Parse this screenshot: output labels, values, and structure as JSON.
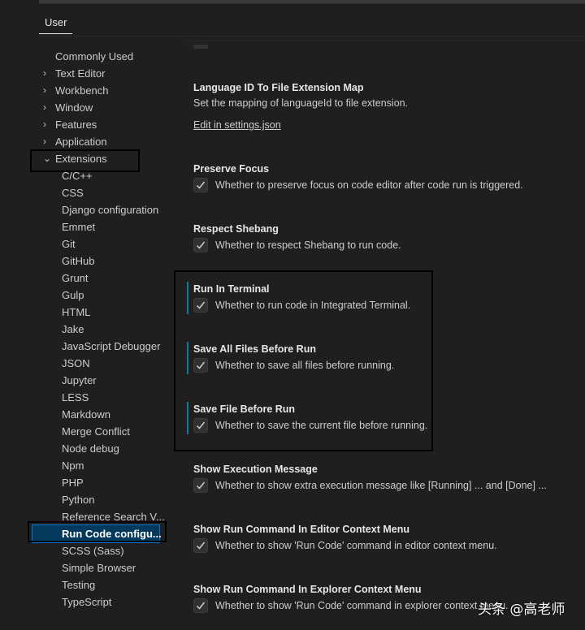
{
  "tabs": [
    {
      "label": "User",
      "active": true
    }
  ],
  "sidebar": {
    "items": [
      {
        "label": "Commonly Used",
        "chevron": ""
      },
      {
        "label": "Text Editor",
        "chevron": "›"
      },
      {
        "label": "Workbench",
        "chevron": "›"
      },
      {
        "label": "Window",
        "chevron": "›"
      },
      {
        "label": "Features",
        "chevron": "›"
      },
      {
        "label": "Application",
        "chevron": "›"
      },
      {
        "label": "Extensions",
        "chevron": "⌄"
      }
    ],
    "extensions": [
      "C/C++",
      "CSS",
      "Django configuration",
      "Emmet",
      "Git",
      "GitHub",
      "Grunt",
      "Gulp",
      "HTML",
      "Jake",
      "JavaScript Debugger",
      "JSON",
      "Jupyter",
      "LESS",
      "Markdown",
      "Merge Conflict",
      "Node debug",
      "Npm",
      "PHP",
      "Python",
      "Reference Search V...",
      "Run Code configu...",
      "SCSS (Sass)",
      "Simple Browser",
      "Testing",
      "TypeScript"
    ],
    "selected": "Run Code configu..."
  },
  "settings": [
    {
      "title": "Language ID To File Extension Map",
      "description": "Set the mapping of languageId to file extension.",
      "link": "Edit in settings.json"
    },
    {
      "title": "Preserve Focus",
      "description": "Whether to preserve focus on code editor after code run is triggered.",
      "checked": true
    },
    {
      "title": "Respect Shebang",
      "description": "Whether to respect Shebang to run code.",
      "checked": true
    },
    {
      "title": "Run In Terminal",
      "description": "Whether to run code in Integrated Terminal.",
      "checked": true,
      "modified": true
    },
    {
      "title": "Save All Files Before Run",
      "description": "Whether to save all files before running.",
      "checked": true,
      "modified": true
    },
    {
      "title": "Save File Before Run",
      "description": "Whether to save the current file before running.",
      "checked": true,
      "modified": true
    },
    {
      "title": "Show Execution Message",
      "description": "Whether to show extra execution message like [Running] ... and [Done] ...",
      "checked": true
    },
    {
      "title": "Show Run Command In Editor Context Menu",
      "description": "Whether to show 'Run Code' command in editor context menu.",
      "checked": true
    },
    {
      "title": "Show Run Command In Explorer Context Menu",
      "description": "Whether to show 'Run Code' command in explorer context menu.",
      "checked": true
    }
  ],
  "colors": {
    "modified_indicator": "#0c7d9d",
    "selection_bg": "#04395e",
    "focus_border": "#0078d4"
  },
  "watermark": "头条 @高老师"
}
